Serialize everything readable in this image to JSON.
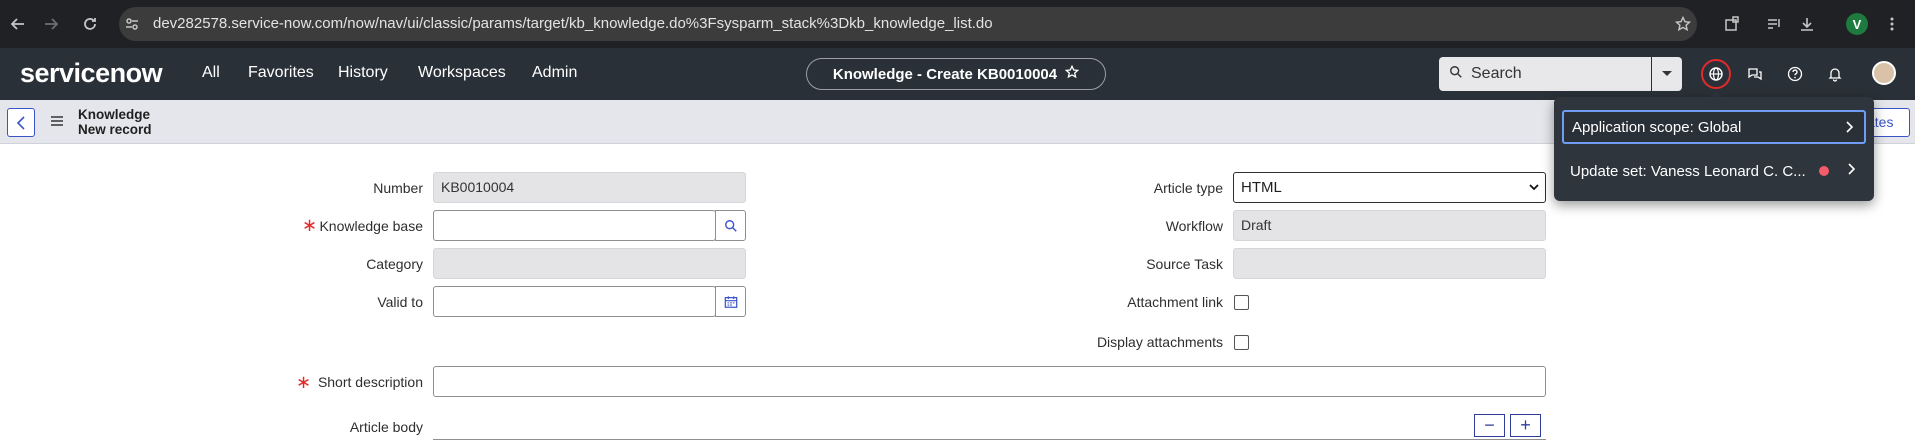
{
  "browser": {
    "url": "dev282578.service-now.com/now/nav/ui/classic/params/target/kb_knowledge.do%3Fsysparm_stack%3Dkb_knowledge_list.do",
    "profile_initial": "V"
  },
  "header": {
    "logo": "servicenow",
    "nav": [
      "All",
      "Favorites",
      "History",
      "Workspaces",
      "Admin"
    ],
    "page_title": "Knowledge - Create KB0010004",
    "search_placeholder": "Search"
  },
  "formbar": {
    "title_line1": "Knowledge",
    "title_line2": "New record",
    "right_button": "ates"
  },
  "form": {
    "number_label": "Number",
    "number_value": "KB0010004",
    "kb_label": "Knowledge base",
    "category_label": "Category",
    "valid_to_label": "Valid to",
    "article_type_label": "Article type",
    "article_type_value": "HTML",
    "workflow_label": "Workflow",
    "workflow_value": "Draft",
    "source_task_label": "Source Task",
    "attachment_link_label": "Attachment link",
    "display_attachments_label": "Display attachments",
    "short_desc_label": "Short description",
    "article_body_label": "Article body",
    "required_marker": "∗"
  },
  "popup": {
    "scope": "Application scope: Global",
    "update_set": "Update set: Vaness Leonard C. C..."
  }
}
